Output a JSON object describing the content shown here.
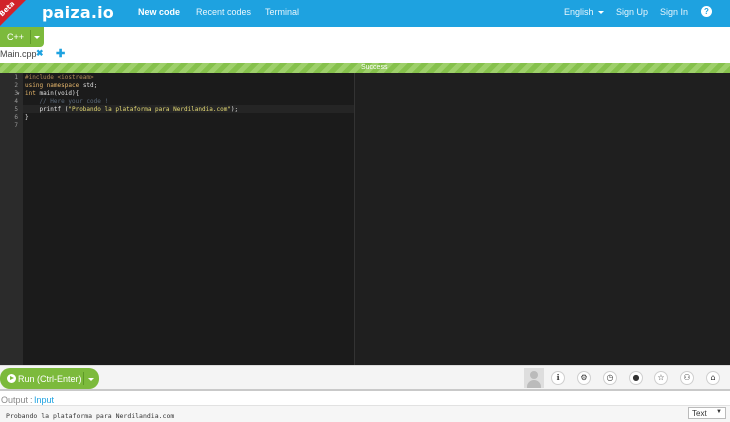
{
  "navbar": {
    "beta": "Beta",
    "logo": "paiza.io",
    "links": [
      {
        "label": "New code"
      },
      {
        "label": "Recent codes"
      },
      {
        "label": "Terminal"
      }
    ],
    "language": "English",
    "sign_up": "Sign Up",
    "sign_in": "Sign In",
    "help_glyph": "?"
  },
  "language_button": {
    "label": "C++"
  },
  "tabs": {
    "file": "Main.cpp",
    "close_glyph": "✖",
    "add_glyph": "✚"
  },
  "progress": {
    "label": "Success",
    "fraction": 1.0
  },
  "editor": {
    "line_numbers": [
      "1",
      "2",
      "3",
      "4",
      "5",
      "6",
      "7"
    ],
    "lines": {
      "l1": "#include <iostream>",
      "l2_kw1": "using",
      "l2_kw2": "namespace",
      "l2_rest": " std;",
      "l3_kw": "int",
      "l3_rest": " main(void){",
      "l4": "    // Here your code !",
      "l5_pre": "    printf (",
      "l5_str": "\"Probando la plataforma para Nerdilandia.com\"",
      "l5_post": ");",
      "l6": "}",
      "l7": ""
    }
  },
  "toolbar": {
    "run_label": "Run (Ctrl-Enter)",
    "icons": [
      "info-icon",
      "gear-icon",
      "clock-icon",
      "github-icon",
      "star-icon",
      "users-icon",
      "lock-icon"
    ]
  },
  "output": {
    "tab_output": "Output",
    "tab_input": "Input",
    "text": "Probando la plataforma para Nerdilandia.com",
    "format": "Text"
  },
  "colors": {
    "navbar": "#1ea2e0",
    "accent_green": "#7cba3c",
    "editor_bg": "#1b1b1b"
  }
}
